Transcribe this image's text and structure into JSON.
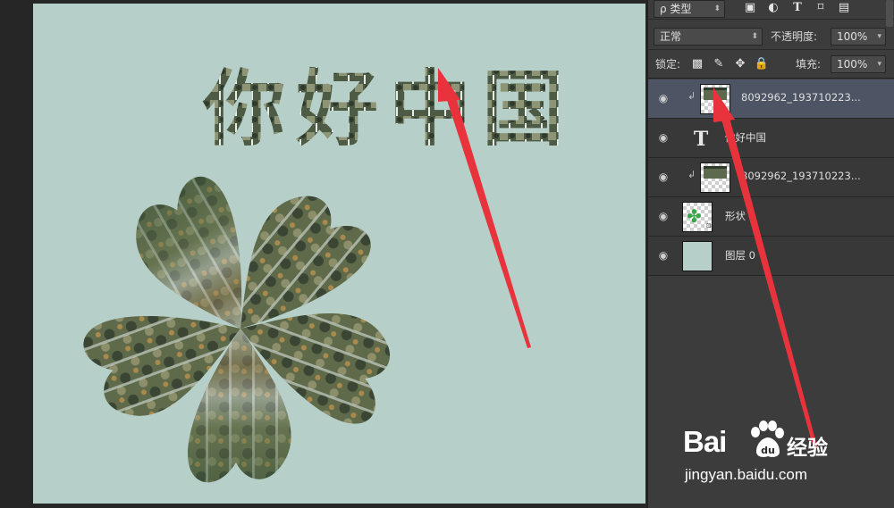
{
  "canvas": {
    "headline": "你好中国",
    "background_color": "#b6d0c9"
  },
  "panel": {
    "filter": {
      "label": "ρ 类型",
      "icons": [
        "image-filter-icon",
        "adjustment-filter-icon",
        "type-filter-icon",
        "shape-filter-icon",
        "smart-object-filter-icon"
      ]
    },
    "blend_mode": "正常",
    "opacity_label": "不透明度:",
    "opacity_value": "100%",
    "lock_label": "锁定:",
    "fill_label": "填充:",
    "fill_value": "100%",
    "layers": [
      {
        "name": "8092962_193710223...",
        "type": "clipped-image",
        "selected": true
      },
      {
        "name": "你好中国",
        "type": "text",
        "selected": false
      },
      {
        "name": "8092962_193710223...",
        "type": "clipped-image",
        "selected": false
      },
      {
        "name": "形状 1",
        "type": "shape",
        "selected": false
      },
      {
        "name": "图层 0",
        "type": "fill",
        "selected": false
      }
    ]
  },
  "watermark": {
    "brand_a": "Bai",
    "brand_b": "经验",
    "url": "jingyan.baidu.com"
  },
  "colors": {
    "arrow": "#e8323c",
    "panel_bg": "#3c3c3c",
    "selected_layer": "#4d5565"
  }
}
